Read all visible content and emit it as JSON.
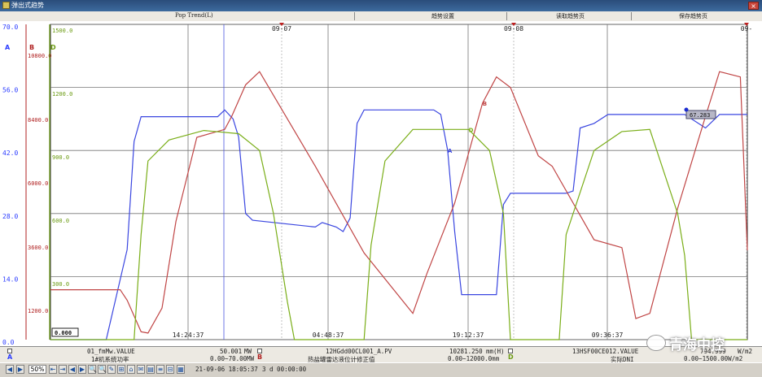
{
  "window": {
    "title": "弹出式趋势",
    "close_glyph": "×"
  },
  "menu": [
    "Pop Trend(L)",
    "趋势设置",
    "读取趋势页",
    "保存趋势页"
  ],
  "axes": {
    "A": {
      "ticks": [
        "70.0",
        "56.0",
        "42.0",
        "28.0",
        "14.0",
        "0.0"
      ],
      "color": "#2b3cff",
      "letter": "A"
    },
    "B": {
      "ticks": [
        "10800.0",
        "8400.0",
        "6000.0",
        "3600.0",
        "1200.0"
      ],
      "color": "#b02020",
      "letter": "B"
    },
    "D": {
      "ticks": [
        "1500.0",
        "1200.0",
        "900.0",
        "600.0",
        "300.0"
      ],
      "color": "#6a9a10",
      "letter": "D"
    }
  },
  "dates": [
    "09-07",
    "09-08",
    "09-"
  ],
  "times": [
    "14:24:37",
    "04:48:37",
    "19:12:37",
    "09:36:37"
  ],
  "cursor_value": "0.000",
  "tooltip_value": "67.283",
  "trace_labels": {
    "A": "A",
    "B": "B",
    "D": "D"
  },
  "chart_data": {
    "type": "line",
    "x_labels": [
      "14:24:37",
      "04:48:37",
      "19:12:37",
      "09:36:37"
    ],
    "series": [
      {
        "name": "1#机系统功率",
        "axis": "A",
        "color": "#3a46e0",
        "points": [
          [
            0,
            0
          ],
          [
            8,
            0
          ],
          [
            11,
            20
          ],
          [
            12,
            44
          ],
          [
            13,
            49.5
          ],
          [
            24,
            49.5
          ],
          [
            25,
            51
          ],
          [
            26.2,
            49
          ],
          [
            27,
            45
          ],
          [
            28,
            28
          ],
          [
            29,
            26.5
          ],
          [
            38,
            25
          ],
          [
            39,
            26
          ],
          [
            41,
            25
          ],
          [
            42,
            24
          ],
          [
            43,
            27
          ],
          [
            44,
            48
          ],
          [
            45,
            51
          ],
          [
            55,
            51
          ],
          [
            56,
            50
          ],
          [
            57,
            42
          ],
          [
            58,
            24
          ],
          [
            59,
            10
          ],
          [
            60,
            10
          ],
          [
            64,
            10
          ],
          [
            65,
            30
          ],
          [
            66,
            32.5
          ],
          [
            74,
            32.5
          ],
          [
            75,
            33
          ],
          [
            76,
            47
          ],
          [
            78,
            48
          ],
          [
            80,
            50
          ],
          [
            90,
            50
          ],
          [
            91,
            50
          ],
          [
            92,
            49
          ],
          [
            94,
            47
          ],
          [
            96,
            50
          ],
          [
            100,
            50
          ]
        ]
      },
      {
        "name": "热盐罐雷达液位计修正值",
        "axis": "B",
        "color": "#c04545",
        "points": [
          [
            0,
            1900
          ],
          [
            10,
            1900
          ],
          [
            11,
            1500
          ],
          [
            13,
            300
          ],
          [
            14,
            250
          ],
          [
            16,
            1200
          ],
          [
            18,
            4500
          ],
          [
            21,
            7700
          ],
          [
            25,
            8000
          ],
          [
            26,
            8500
          ],
          [
            28,
            9700
          ],
          [
            30,
            10200
          ],
          [
            38,
            6600
          ],
          [
            45,
            3300
          ],
          [
            52,
            1000
          ],
          [
            54,
            2500
          ],
          [
            58,
            5200
          ],
          [
            62,
            9000
          ],
          [
            64,
            10000
          ],
          [
            66,
            9600
          ],
          [
            70,
            7000
          ],
          [
            72,
            6600
          ],
          [
            78,
            3800
          ],
          [
            82,
            3500
          ],
          [
            84,
            800
          ],
          [
            86,
            1000
          ],
          [
            90,
            5000
          ],
          [
            94,
            8500
          ],
          [
            96,
            10200
          ],
          [
            99,
            10000
          ],
          [
            100,
            3400
          ]
        ]
      },
      {
        "name": "实际DNI",
        "axis": "D",
        "color": "#7aae18",
        "points": [
          [
            0,
            0
          ],
          [
            12,
            0
          ],
          [
            13,
            500
          ],
          [
            14,
            850
          ],
          [
            17,
            950
          ],
          [
            22,
            995
          ],
          [
            27,
            980
          ],
          [
            30,
            900
          ],
          [
            32,
            600
          ],
          [
            34,
            180
          ],
          [
            35,
            0
          ],
          [
            45,
            0
          ],
          [
            46,
            450
          ],
          [
            48,
            850
          ],
          [
            52,
            1000
          ],
          [
            60,
            1000
          ],
          [
            63,
            900
          ],
          [
            65,
            600
          ],
          [
            66,
            0
          ],
          [
            73,
            0
          ],
          [
            74,
            500
          ],
          [
            78,
            900
          ],
          [
            82,
            990
          ],
          [
            86,
            1000
          ],
          [
            88,
            800
          ],
          [
            90,
            600
          ],
          [
            91,
            400
          ],
          [
            92,
            0
          ],
          [
            100,
            0
          ]
        ]
      }
    ]
  },
  "footer": {
    "A": {
      "tag": "01_fmMw.VALUE",
      "value": "50.001",
      "unit": "MW",
      "desc": "1#机系统功率",
      "range": "0.00~70.00MW"
    },
    "B": {
      "tag": "12HGdd00CL001_A.PV",
      "value": "10281.250",
      "unit": "mm(H)",
      "desc": "热盐罐雷达液位计修正值",
      "range": "0.00~12000.0mm"
    },
    "D": {
      "tag": "13HSF00CE012.VALUE",
      "value": "794.999",
      "unit": "W/m2",
      "desc": "实际DNI",
      "range": "0.00~1500.00W/m2"
    }
  },
  "status": {
    "zoom": "50%",
    "datetime": "21-09-06 18:05:37",
    "span": "3 d 00:00:00"
  },
  "toolbar_glyphs": [
    "◀",
    "▶",
    "⇤",
    "⇥",
    "◀",
    "▶",
    "🔍",
    "🔍",
    "✎",
    "⊞",
    "⌂",
    "✉",
    "▤",
    "≡",
    "⊟",
    "▦"
  ],
  "watermark": {
    "text": "青海中控"
  }
}
